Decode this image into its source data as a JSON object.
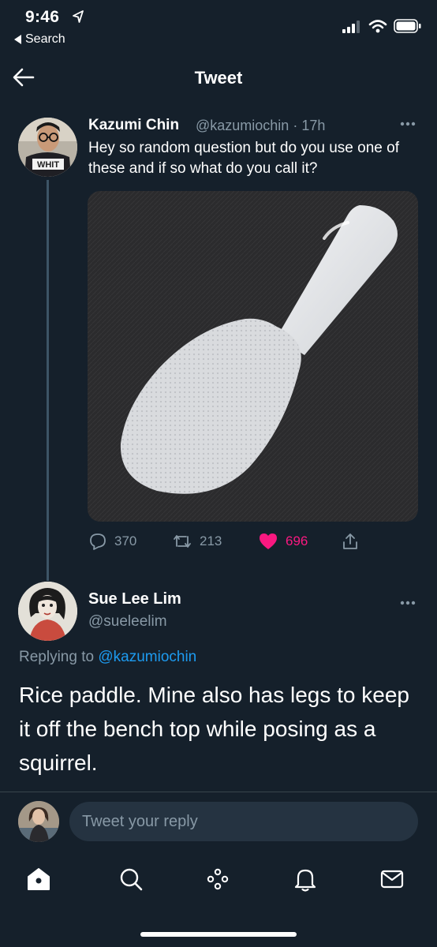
{
  "status_bar": {
    "time": "9:46",
    "back_label": "Search"
  },
  "header": {
    "title": "Tweet"
  },
  "original_tweet": {
    "name": "Kazumi Chin",
    "handle_time": "@kazumiochin · 17h",
    "text": "Hey so random question but do you use one of these and if so what do you call it?",
    "media_description": "white rice paddle on dark textured surface",
    "avatar_shirt_text": "WHIT",
    "actions": {
      "replies": "370",
      "retweets": "213",
      "likes": "696",
      "liked": true
    }
  },
  "reply_tweet": {
    "name": "Sue Lee Lim",
    "handle": "@sueleelim",
    "replying_prefix": "Replying to",
    "replying_to": "@kazumiochin",
    "text": "Rice paddle. Mine also has legs to keep it off the bench top while posing as a squirrel."
  },
  "compose": {
    "placeholder": "Tweet your reply"
  },
  "bottom_nav": {
    "items": [
      "home-icon",
      "search-icon",
      "spaces-icon",
      "notifications-icon",
      "messages-icon"
    ]
  },
  "colors": {
    "background": "#15202b",
    "secondary_text": "#8899a6",
    "accent": "#1d9bf0",
    "like": "#f91880",
    "divider": "#38444d"
  }
}
